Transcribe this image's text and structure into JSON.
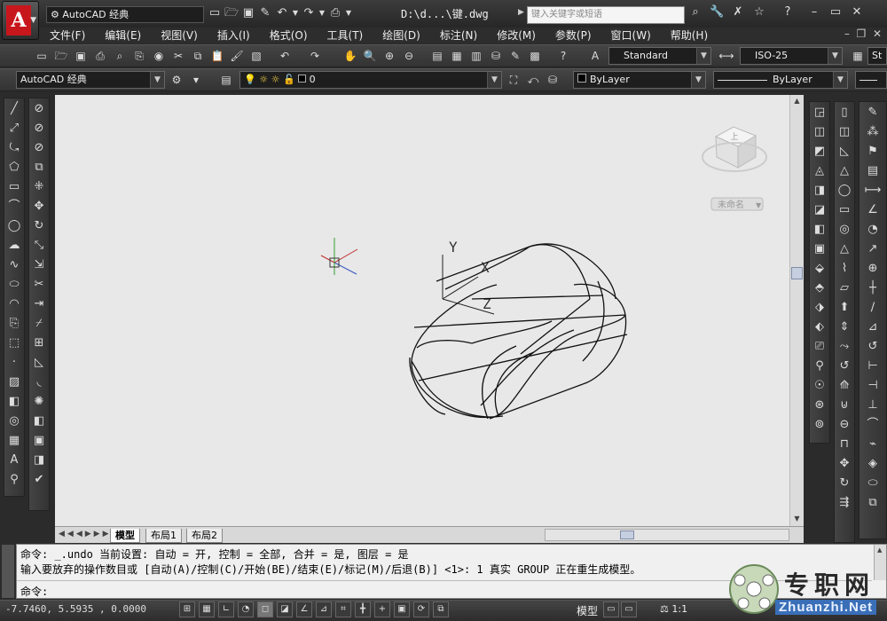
{
  "app": {
    "logo": "A",
    "workspace": "AutoCAD 经典",
    "document_title": "D:\\d...\\键.dwg",
    "search_placeholder": "键入关键字或短语"
  },
  "menu": [
    "文件(F)",
    "编辑(E)",
    "视图(V)",
    "插入(I)",
    "格式(O)",
    "工具(T)",
    "绘图(D)",
    "标注(N)",
    "修改(M)",
    "参数(P)",
    "窗口(W)",
    "帮助(H)"
  ],
  "styles": {
    "text_style": "Standard",
    "dim_style": "ISO-25",
    "table_style_abbrev": "St"
  },
  "workspace_combo": "AutoCAD 经典",
  "layer": {
    "name": "0"
  },
  "properties": {
    "color": "ByLayer",
    "linetype": "ByLayer"
  },
  "viewcube": {
    "top_label": "上",
    "view_name": "未命名"
  },
  "ucs": {
    "x": "X",
    "y": "Y",
    "z": "Z"
  },
  "layout_tabs": [
    "模型",
    "布局1",
    "布局2"
  ],
  "command": {
    "history": [
      "命令:  _.undo 当前设置: 自动 = 开, 控制 = 全部, 合并 = 是, 图层 = 是",
      "输入要放弃的操作数目或 [自动(A)/控制(C)/开始(BE)/结束(E)/标记(M)/后退(B)] <1>: 1 真实 GROUP 正在重生成模型。"
    ],
    "prompt": "命令:"
  },
  "status": {
    "coordinates": "-7.7460,  5.5935 , 0.0000",
    "space": "模型",
    "scale": "1:1"
  },
  "watermark": {
    "title": "专职网",
    "url": "Zhuanzhi.Net"
  },
  "colors": {
    "canvas": "#e8e8e8",
    "ui_dark": "#2b2b2b",
    "logo_red": "#c8161d",
    "ucs_x": "#c03030",
    "ucs_y": "#30a030",
    "ucs_z": "#3050c0"
  }
}
